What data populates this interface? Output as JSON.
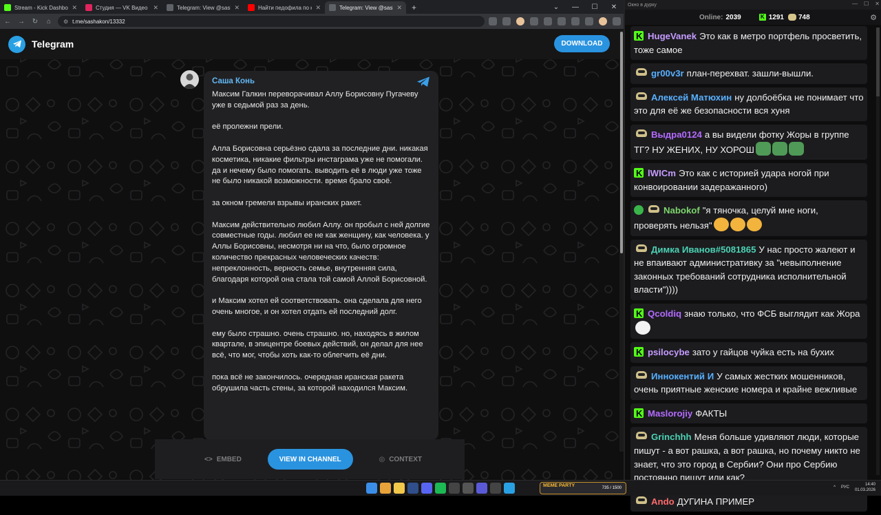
{
  "browser": {
    "tabs": [
      {
        "title": "Stream - Kick Dashboard",
        "color": "#53fc18"
      },
      {
        "title": "Студия — VK Видео Live",
        "color": "#e0245e"
      },
      {
        "title": "Telegram: View @sashakon",
        "color": "#5f6368"
      },
      {
        "title": "Найти педофила по кирпичу",
        "color": "#ff0000"
      },
      {
        "title": "Telegram: View @sashakon",
        "color": "#5f6368"
      }
    ],
    "new_tab": "+",
    "url": "t.me/sashakon/13332"
  },
  "telegram": {
    "brand": "Telegram",
    "download_label": "DOWNLOAD",
    "author": "Саша Конь",
    "paragraphs": [
      "Максим Галкин переворачивал Аллу Борисовну Пугачеву уже в седьмой раз за день.",
      "её пролежни прели.",
      "Алла Борисовна серьёзно сдала за последние дни. никакая косметика, никакие фильтры инстаграма уже не помогали. да и нечему было помогать. выводить её в люди уже тоже не было никакой возможности. время брало своё.",
      "за окном гремели взрывы иранских ракет.",
      "Максим действительно любил Аллу. он пробыл с ней долгие совместные годы. любил ее не как женщину, как человека. у Аллы Борисовны, несмотря ни на что, было огромное количество прекрасных человеческих качеств: непреклонность, верность семье, внутренняя сила, благодаря которой она стала той самой Аллой Борисовной.",
      "и Максим хотел ей соответствовать. она сделала для него очень многое, и он хотел отдать ей последний долг.",
      "ему было страшно. очень страшно. но, находясь в жилом квартале, в эпицентре боевых действий, он делал для нее всё, что мог, чтобы хоть как-то облегчить её дни.",
      "пока всё не закончилось. очередная иранская ракета обрушила часть стены, за которой находился Максим."
    ],
    "embed_label": "EMBED",
    "view_label": "VIEW IN CHANNEL",
    "context_label": "CONTEXT"
  },
  "chat_window": {
    "title": "Окно в дурку",
    "online_label": "Online:",
    "online_count": "2039",
    "kick_count": "1291",
    "vk_count": "748"
  },
  "chat": [
    {
      "badge": "kick",
      "user": "HugeVanek",
      "color": "#c59bff",
      "text": "Это как в метро портфель просветить, тоже самое",
      "emotes": []
    },
    {
      "badge": "vk",
      "user": "gr00v3r",
      "color": "#58b0ff",
      "text": "план-перехват. зашли-вышли.",
      "emotes": []
    },
    {
      "badge": "vk",
      "user": "Алексей Матюхин",
      "color": "#58b0ff",
      "text": "ну долбоёбка не понимает что это для её же безопасности вся хуня",
      "emotes": []
    },
    {
      "badge": "vk",
      "user": "Выдра0124",
      "color": "#b36bff",
      "text": "а вы видели фотку Жоры в группе ТГ? НУ ЖЕНИХ, НУ ХОРОШ",
      "emotes": [
        "pepe",
        "pepe",
        "pepe"
      ]
    },
    {
      "badge": "kick",
      "user": "lWICm",
      "color": "#c59bff",
      "text": "Это как с историей удара ногой при конвоировании задеражанного)",
      "emotes": []
    },
    {
      "badge": "verified",
      "user": "Nabokof",
      "color": "#7dd66c",
      "text": "\"я тяночка, целуй мне ноги, проверять нельзя\"",
      "emotes": [
        "face",
        "face",
        "face"
      ]
    },
    {
      "badge": "vk",
      "user": "Димка Иванов#5081865",
      "color": "#4cd2b4",
      "text": "У нас просто жалеют и не впаивают административку за \"невыполнение законных требований сотрудника исполнительной власти\"))))",
      "emotes": []
    },
    {
      "badge": "kick",
      "user": "Qcoldiq",
      "color": "#b36bff",
      "text": "знаю только, что ФСБ выглядит как Жора",
      "emotes": [
        "troll"
      ]
    },
    {
      "badge": "kick",
      "user": "psilocybe",
      "color": "#c59bff",
      "text": "зато у гайцов чуйка есть на бухих",
      "emotes": []
    },
    {
      "badge": "vk",
      "user": "Иннокентий И",
      "color": "#58b0ff",
      "text": "У самых жестких мошенников, очень приятные женские номера и крайне вежливые",
      "emotes": []
    },
    {
      "badge": "kick",
      "user": "Maslorojiy",
      "color": "#b36bff",
      "text": "ФАКТЫ",
      "emotes": []
    },
    {
      "badge": "vk",
      "user": "Grinchhh",
      "color": "#4cd2b4",
      "text": "Меня больше удивляют люди, которые пишут - а вот рашка, а вот рашка, но почему никто не знает, что это город в Сербии? Они про Сербию постоянно пишут или как?",
      "emotes": []
    },
    {
      "badge": "vk",
      "user": "Ando",
      "color": "#ff6b6b",
      "text": "ДУГИНА ПРИМЕР",
      "emotes": []
    }
  ],
  "taskbar": {
    "meme_label": "MEME PARTY",
    "meme_count": "735 / 1500",
    "lang": "РУС",
    "time": "14:40",
    "date": "01.03.2026"
  }
}
